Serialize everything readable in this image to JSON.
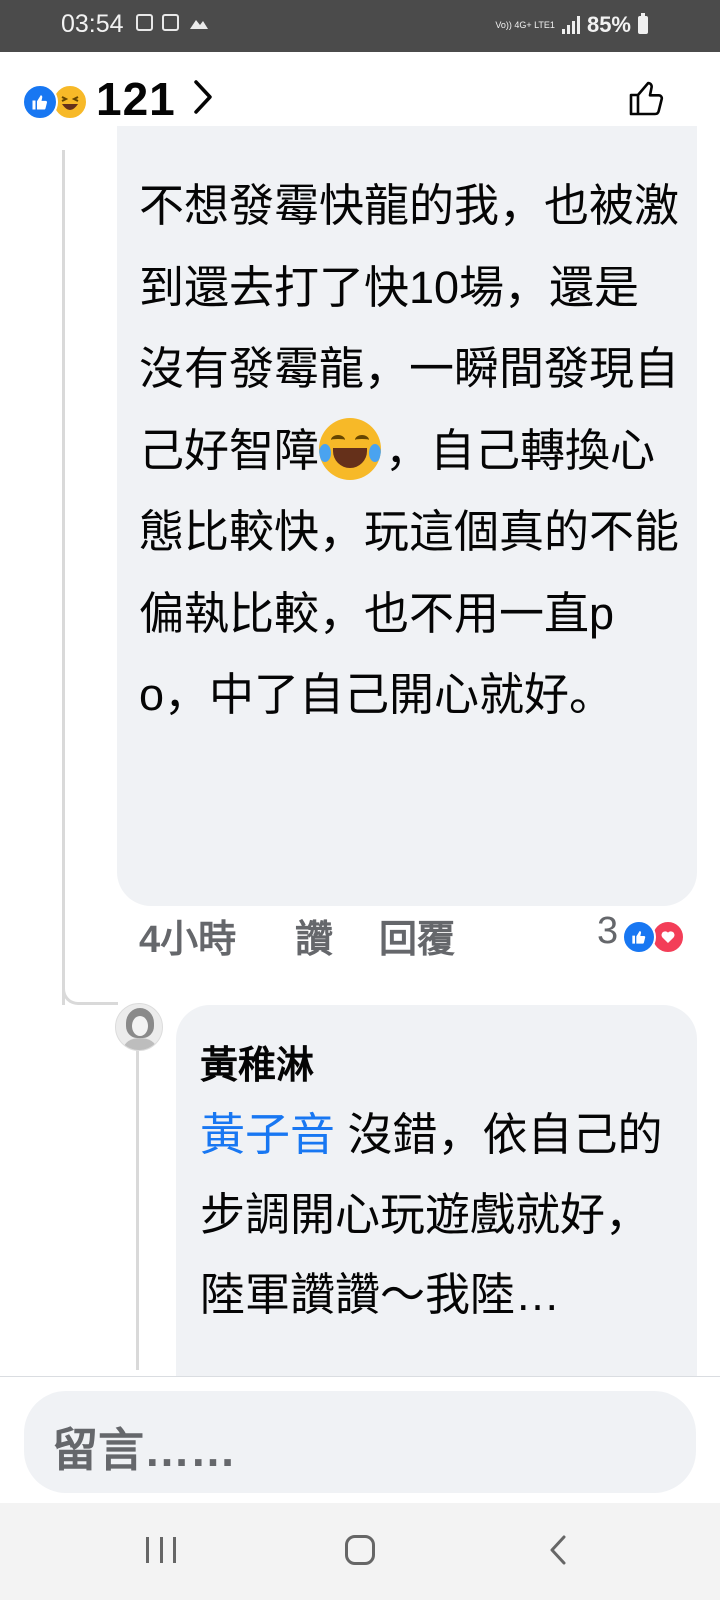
{
  "status_bar": {
    "time": "03:54",
    "network": "Vo)) 4G+ LTE1",
    "battery": "85%"
  },
  "header": {
    "reaction_count": "121",
    "reactions": [
      "like-icon",
      "haha-icon"
    ]
  },
  "comment1": {
    "text_before_emoji": "不想發霉快龍的我，也被激到還去打了快10場，還是沒有發霉龍，一瞬間發現自己好智障",
    "emoji": "tears-of-joy",
    "text_after_emoji": "，自己轉換心態比較快，玩這個真的不能偏執比較，也不用一直po，中了自己開心就好。",
    "time": "4小時",
    "like_label": "讚",
    "reply_label": "回覆",
    "reaction_count": "3",
    "reactions": [
      "like-icon",
      "love-icon"
    ]
  },
  "comment2": {
    "author": "黃稚淋",
    "mention": "黃子音",
    "text": " 沒錯，依自己的步調開心玩遊戲就好，陸軍讚讚～我陸…"
  },
  "composer": {
    "placeholder": "留言……"
  },
  "colors": {
    "accent": "#1877f2",
    "bubble": "#f0f2f5",
    "muted": "#65676b",
    "love": "#f33e58",
    "haha": "#f7b928"
  }
}
